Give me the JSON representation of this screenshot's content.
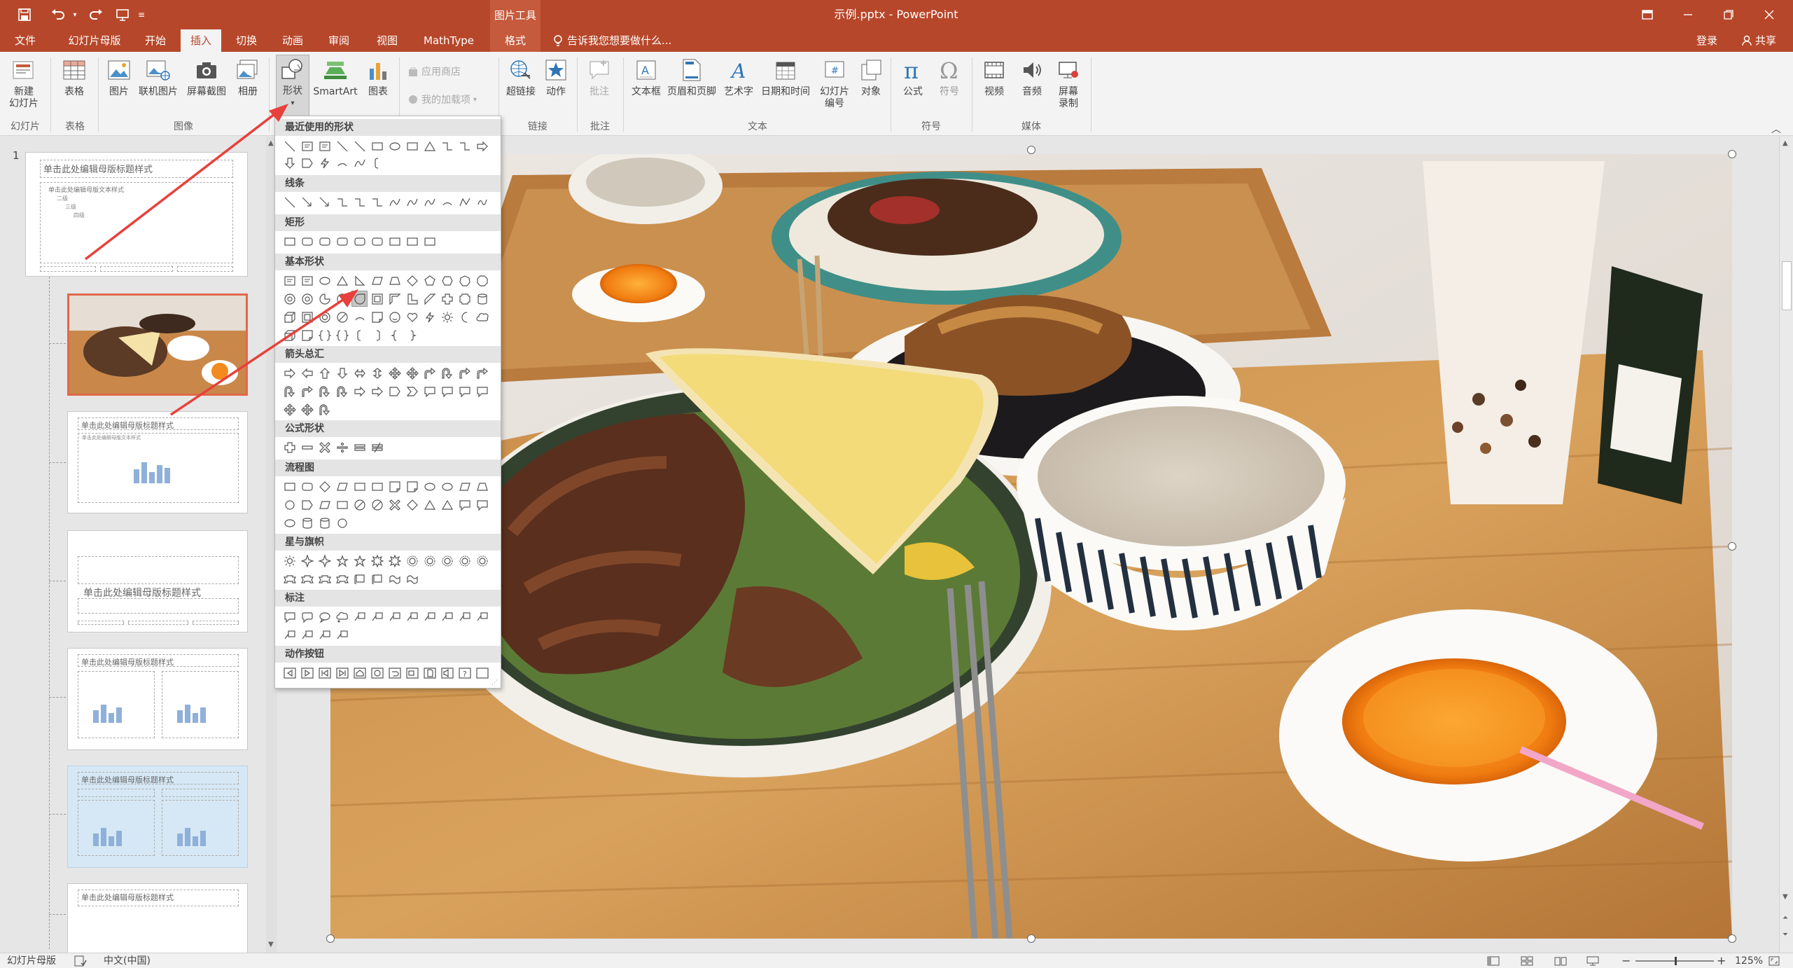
{
  "window": {
    "title": "示例.pptx - PowerPoint",
    "context_group": "图片工具"
  },
  "tabs": [
    {
      "label": "文件"
    },
    {
      "label": "幻灯片母版"
    },
    {
      "label": "开始"
    },
    {
      "label": "插入"
    },
    {
      "label": "切换"
    },
    {
      "label": "动画"
    },
    {
      "label": "审阅"
    },
    {
      "label": "视图"
    },
    {
      "label": "MathType"
    },
    {
      "label": "格式"
    }
  ],
  "tell_me": "告诉我您想要做什么...",
  "account": {
    "login": "登录",
    "share": "共享"
  },
  "ribbon": {
    "new_slide": "新建\n幻灯片",
    "table": "表格",
    "picture": "图片",
    "online_picture": "联机图片",
    "screenshot": "屏幕截图",
    "album": "相册",
    "shapes": "形状",
    "smartart": "SmartArt",
    "chart": "图表",
    "store": "应用商店",
    "my_addins": "我的加载项",
    "hyperlink": "超链接",
    "action": "动作",
    "comment": "批注",
    "textbox": "文本框",
    "header_footer": "页眉和页脚",
    "wordart": "艺术字",
    "datetime": "日期和时间",
    "slide_number": "幻灯片\n编号",
    "object": "对象",
    "equation": "公式",
    "symbol": "符号",
    "video": "视频",
    "audio": "音频",
    "screen_record": "屏幕\n录制",
    "groups": {
      "slides": "幻灯片",
      "tables": "表格",
      "images": "图像",
      "links": "链接",
      "comments": "批注",
      "text": "文本",
      "symbols": "符号",
      "media": "媒体"
    }
  },
  "gallery": {
    "sections": [
      "最近使用的形状",
      "线条",
      "矩形",
      "基本形状",
      "箭头总汇",
      "公式形状",
      "流程图",
      "星与旗帜",
      "标注",
      "动作按钮"
    ]
  },
  "thumbnails": {
    "number": "1",
    "master_title": "单击此处编辑母版标题样式",
    "master_text": "单击此处编辑母版文本样式",
    "level2": "二级",
    "level3": "三级",
    "level4": "四级"
  },
  "status": {
    "view": "幻灯片母版",
    "language": "中文(中国)",
    "zoom": "125%"
  },
  "colors": {
    "accent": "#b7472a",
    "annotation_arrow": "#e8403a"
  }
}
